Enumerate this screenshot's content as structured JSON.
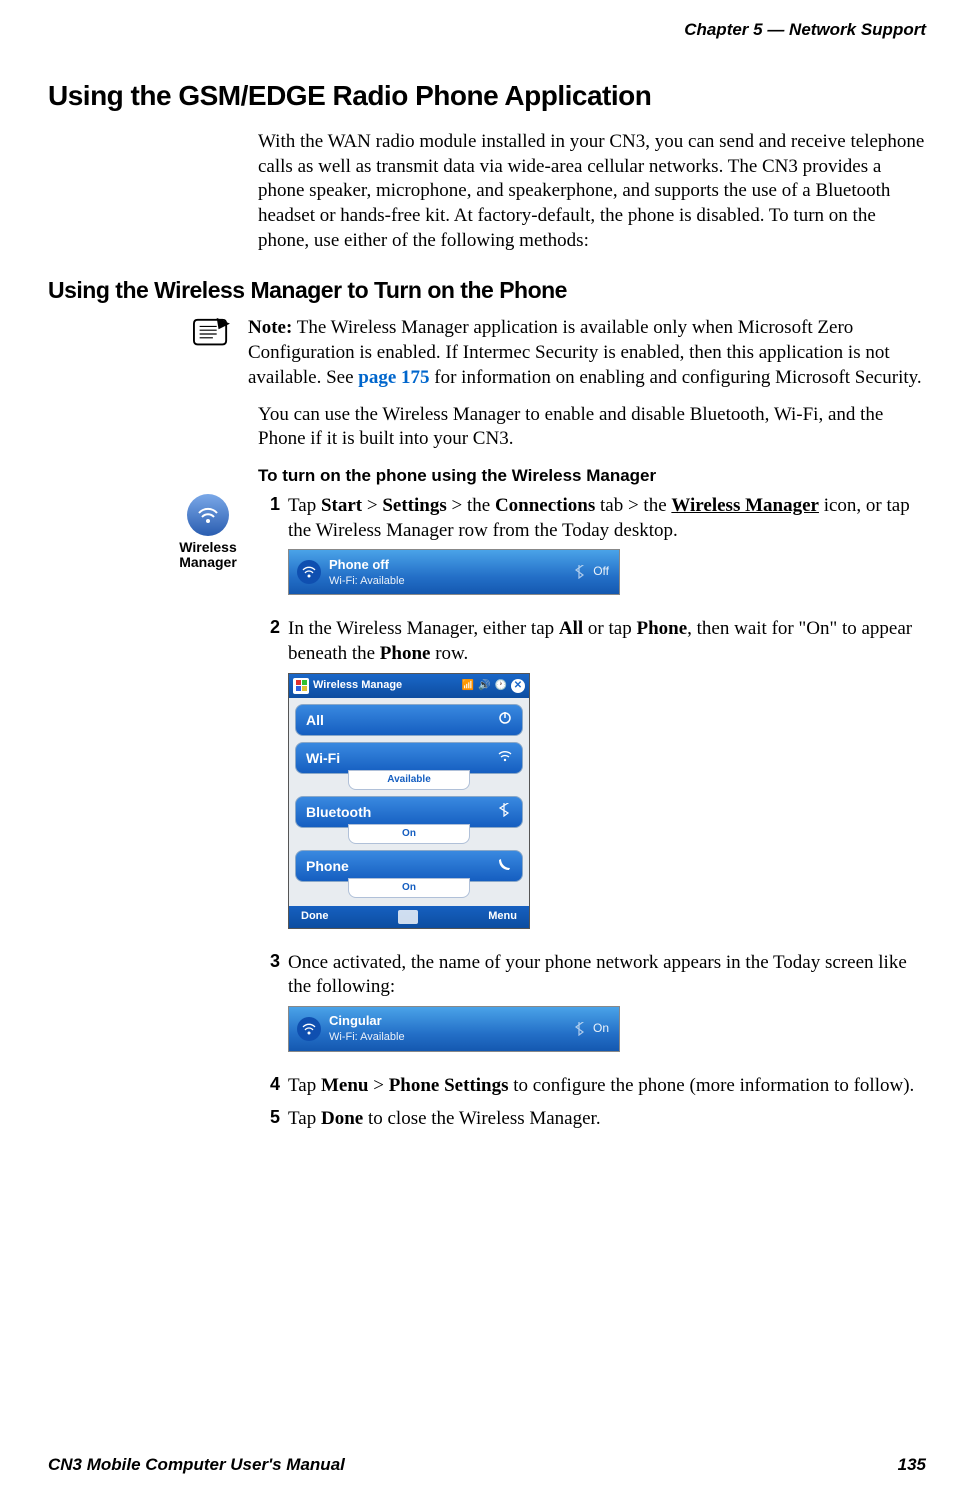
{
  "header": {
    "chapter": "Chapter 5 —  Network Support"
  },
  "h1": "Using the GSM/EDGE Radio Phone Application",
  "intro": "With the WAN radio module installed in your CN3, you can send and receive telephone calls as well as transmit data via wide-area cellular networks. The CN3 provides a phone speaker, microphone, and speakerphone, and supports the use of a Bluetooth headset or hands-free kit. At factory-default, the phone is disabled. To turn on the phone, use either of the following methods:",
  "h2": "Using the Wireless Manager to Turn on the Phone",
  "note": {
    "lead": "Note:",
    "text_before_link": " The Wireless Manager application is available only when Microsoft Zero Configuration is enabled. If Intermec Security is enabled, then this application is not available. See ",
    "link": "page 175",
    "text_after_link": " for information on enabling and configuring Microsoft Security."
  },
  "note_para2": "You can use the Wireless Manager to enable and disable Bluetooth, Wi-Fi, and the Phone if it is built into your CN3.",
  "procedure_title": "To turn on the phone using the Wireless Manager",
  "wireless_badge_label": "Wireless Manager",
  "steps": {
    "s1": {
      "num": "1",
      "pre": "Tap ",
      "b1": "Start",
      "gt1": " > ",
      "b2": "Settings",
      "gt2": " > the ",
      "b3": "Connections",
      "mid": " tab > the ",
      "b4": "Wireless Manager",
      "post": " icon, or tap the Wireless Manager row from the Today desktop."
    },
    "s2": {
      "num": "2",
      "pre": "In the Wireless Manager, either tap ",
      "b1": "All",
      "mid1": " or tap ",
      "b2": "Phone",
      "mid2": ", then wait for \"On\" to appear beneath the ",
      "b3": "Phone",
      "post": " row."
    },
    "s3": {
      "num": "3",
      "text": "Once activated, the name of your phone network appears in the Today screen like the following:"
    },
    "s4": {
      "num": "4",
      "pre": "Tap ",
      "b1": "Menu",
      "gt1": " > ",
      "b2": "Phone Settings",
      "post": " to configure the phone (more information to follow)."
    },
    "s5": {
      "num": "5",
      "pre": "Tap ",
      "b1": "Done",
      "post": " to close the Wireless Manager."
    }
  },
  "today_bar1": {
    "title": "Phone off",
    "sub": "Wi-Fi: Available",
    "right": "Off"
  },
  "wm_screen": {
    "title": "Wireless Manage",
    "rows": {
      "all": {
        "label": "All",
        "icon": "power"
      },
      "wifi": {
        "label": "Wi-Fi",
        "sub": "Available",
        "icon": "wifi"
      },
      "bt": {
        "label": "Bluetooth",
        "sub": "On",
        "icon": "bt"
      },
      "phone": {
        "label": "Phone",
        "sub": "On",
        "icon": "phone"
      }
    },
    "footer": {
      "left": "Done",
      "right": "Menu"
    }
  },
  "today_bar2": {
    "title": "Cingular",
    "sub": "Wi-Fi: Available",
    "right": "On"
  },
  "footer": {
    "left": "CN3 Mobile Computer User's Manual",
    "right": "135"
  }
}
